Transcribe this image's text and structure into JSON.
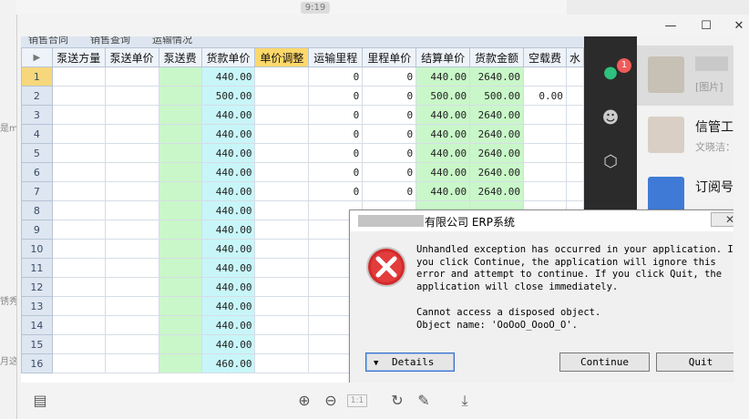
{
  "background": {
    "time_label": "9:19",
    "left_fragments": [
      "是m",
      "锈秀",
      "月这"
    ]
  },
  "viewer": {
    "toolbar_icons": [
      "gallery-icon",
      "zoom-in-icon",
      "zoom-out-icon",
      "actual-size-icon",
      "rotate-icon",
      "edit-icon",
      "download-icon"
    ],
    "actual_size_label": "1:1",
    "window_controls": [
      "minimize",
      "maximize",
      "close"
    ]
  },
  "erp": {
    "tabs": [
      "销售合同",
      "销售查询",
      "运输情况"
    ],
    "columns": [
      "泵送方量",
      "泵送单价",
      "泵送费",
      "货款单价",
      "单价调整",
      "运输里程",
      "里程单价",
      "结算单价",
      "货款金额",
      "空载费",
      "水"
    ],
    "highlight_column": "单价调整",
    "rows": [
      {
        "n": "1",
        "unit": "440.00",
        "dist": "0",
        "dprice": "0",
        "settle": "440.00",
        "amount": "2640.00",
        "empty": ""
      },
      {
        "n": "2",
        "unit": "500.00",
        "dist": "0",
        "dprice": "0",
        "settle": "500.00",
        "amount": "500.00",
        "empty": "0.00"
      },
      {
        "n": "3",
        "unit": "440.00",
        "dist": "0",
        "dprice": "0",
        "settle": "440.00",
        "amount": "2640.00",
        "empty": ""
      },
      {
        "n": "4",
        "unit": "440.00",
        "dist": "0",
        "dprice": "0",
        "settle": "440.00",
        "amount": "2640.00",
        "empty": ""
      },
      {
        "n": "5",
        "unit": "440.00",
        "dist": "0",
        "dprice": "0",
        "settle": "440.00",
        "amount": "2640.00",
        "empty": ""
      },
      {
        "n": "6",
        "unit": "440.00",
        "dist": "0",
        "dprice": "0",
        "settle": "440.00",
        "amount": "2640.00",
        "empty": ""
      },
      {
        "n": "7",
        "unit": "440.00",
        "dist": "0",
        "dprice": "0",
        "settle": "440.00",
        "amount": "2640.00",
        "empty": ""
      },
      {
        "n": "8",
        "unit": "440.00",
        "dist": "",
        "dprice": "",
        "settle": "",
        "amount": "",
        "empty": ""
      },
      {
        "n": "9",
        "unit": "440.00",
        "dist": "",
        "dprice": "",
        "settle": "",
        "amount": "",
        "empty": ""
      },
      {
        "n": "10",
        "unit": "440.00",
        "dist": "",
        "dprice": "",
        "settle": "",
        "amount": "",
        "empty": ""
      },
      {
        "n": "11",
        "unit": "440.00",
        "dist": "",
        "dprice": "",
        "settle": "",
        "amount": "",
        "empty": ""
      },
      {
        "n": "12",
        "unit": "440.00",
        "dist": "",
        "dprice": "",
        "settle": "",
        "amount": "",
        "empty": ""
      },
      {
        "n": "13",
        "unit": "440.00",
        "dist": "",
        "dprice": "",
        "settle": "",
        "amount": "",
        "empty": ""
      },
      {
        "n": "14",
        "unit": "440.00",
        "dist": "",
        "dprice": "",
        "settle": "",
        "amount": "",
        "empty": ""
      },
      {
        "n": "15",
        "unit": "440.00",
        "dist": "",
        "dprice": "",
        "settle": "",
        "amount": "",
        "empty": ""
      },
      {
        "n": "16",
        "unit": "460.00",
        "dist": "",
        "dprice": "",
        "settle": "",
        "amount": "",
        "empty": ""
      }
    ]
  },
  "chat": {
    "badge": "1",
    "items": [
      {
        "name": "",
        "preview": "[图片]"
      },
      {
        "name": "信管工作流",
        "preview": "文晓洁：嗯"
      },
      {
        "name": "订阅号",
        "preview": ""
      }
    ]
  },
  "dialog": {
    "title": "有限公司 ERP系统",
    "close_label": "✕",
    "message": "Unhandled exception has occurred in your application. If\nyou click Continue, the application will ignore this\nerror and attempt to continue. If you click Quit, the\napplication will close immediately.",
    "detail": "Cannot access a disposed object.\nObject name: 'OoOoO_OooO_O'.",
    "details_label": "Details",
    "continue_label": "Continue",
    "quit_label": "Quit"
  }
}
